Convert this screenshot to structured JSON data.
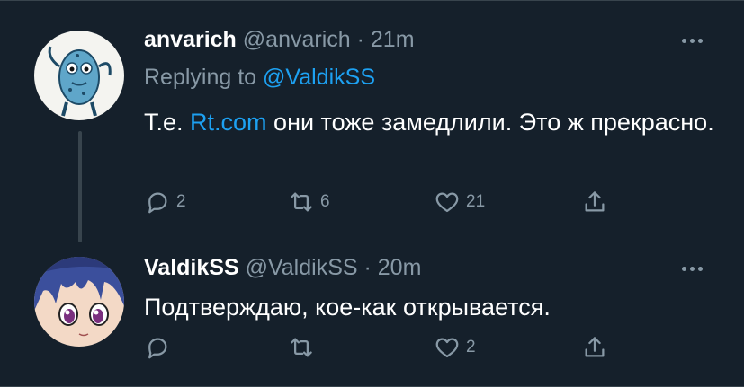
{
  "tweets": [
    {
      "name": "anvarich",
      "handle": "@anvarich",
      "separator": "·",
      "time": "21m",
      "replying_label": "Replying to",
      "replying_handle": "@ValdikSS",
      "text_before": "Т.е. ",
      "link": "Rt.com",
      "text_after": " они тоже замедлили. Это ж прекрасно.",
      "replies": "2",
      "retweets": "6",
      "likes": "21",
      "avatar_icon": "blue-creature-avatar"
    },
    {
      "name": "ValdikSS",
      "handle": "@ValdikSS",
      "separator": "·",
      "time": "20m",
      "text": "Подтверждаю, кое-как открывается.",
      "replies": "",
      "retweets": "",
      "likes": "2",
      "avatar_icon": "anime-girl-avatar"
    }
  ],
  "colors": {
    "background": "#15202b",
    "accent": "#1da1f2",
    "secondary_text": "#8899a6",
    "divider": "#38444d"
  }
}
